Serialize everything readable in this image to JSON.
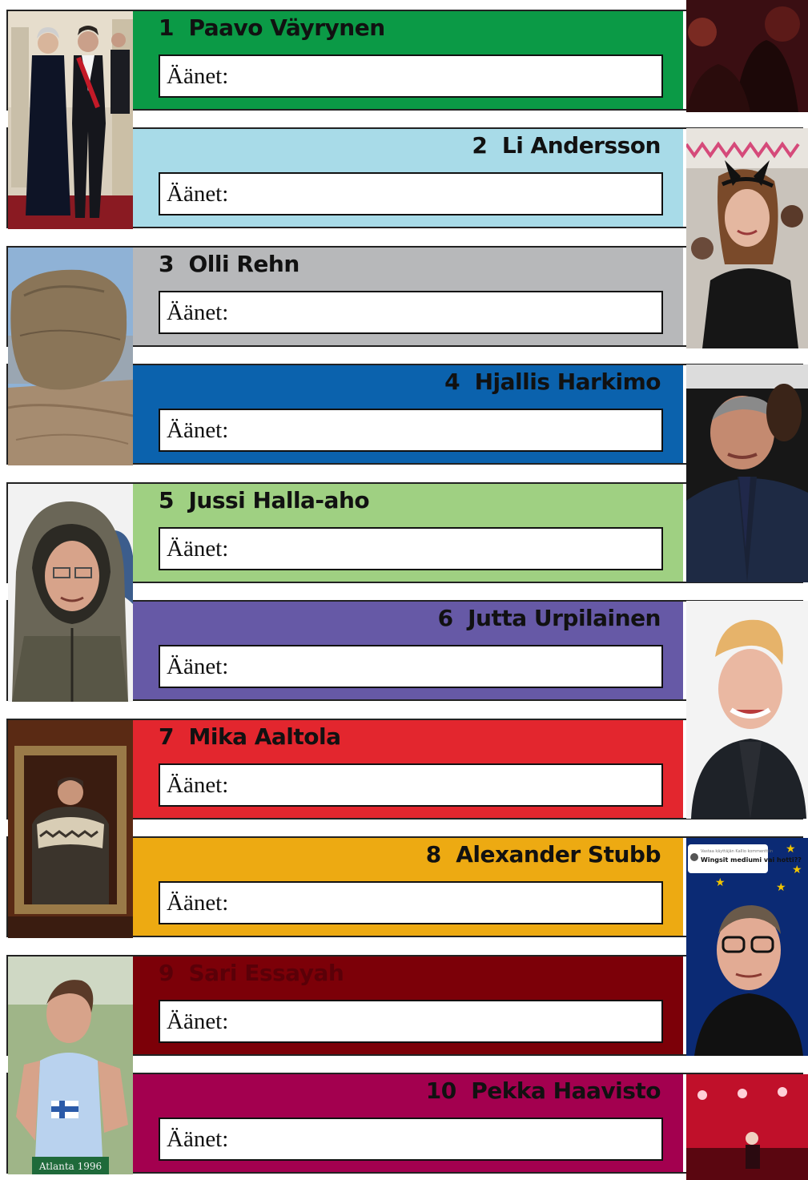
{
  "vote_label": "Äänet:",
  "candidates": [
    {
      "number": "1",
      "name": "Paavo Väyrynen",
      "color": "#0b9a46",
      "text_color": "#111111",
      "align": "left"
    },
    {
      "number": "2",
      "name": "Li Andersson",
      "color": "#a8dbe8",
      "text_color": "#111111",
      "align": "right"
    },
    {
      "number": "3",
      "name": "Olli Rehn",
      "color": "#b7b8ba",
      "text_color": "#111111",
      "align": "left"
    },
    {
      "number": "4",
      "name": "Hjallis Harkimo",
      "color": "#0b62ad",
      "text_color": "#111111",
      "align": "right"
    },
    {
      "number": "5",
      "name": "Jussi Halla-aho",
      "color": "#9fd082",
      "text_color": "#111111",
      "align": "left"
    },
    {
      "number": "6",
      "name": "Jutta Urpilainen",
      "color": "#6659a6",
      "text_color": "#111111",
      "align": "right"
    },
    {
      "number": "7",
      "name": "Mika Aaltola",
      "color": "#e3262e",
      "text_color": "#111111",
      "align": "left"
    },
    {
      "number": "8",
      "name": "Alexander Stubb",
      "color": "#edaa12",
      "text_color": "#111111",
      "align": "right"
    },
    {
      "number": "9",
      "name": "Sari Essayah",
      "color": "#7c0008",
      "text_color": "#5a0008",
      "align": "left"
    },
    {
      "number": "10",
      "name": "Pekka Haavisto",
      "color": "#a3004f",
      "text_color": "#111111",
      "align": "right"
    }
  ],
  "photo_texts": {
    "stubb_caption_small": "Vastaa käyttäjän Kallio kommenttiin",
    "stubb_caption_bold": "Wingsit mediumi vai hotti??",
    "essayah_bib": "Atlanta 1996"
  }
}
